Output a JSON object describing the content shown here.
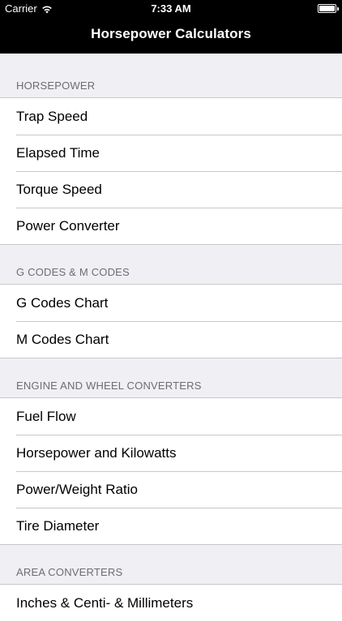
{
  "status_bar": {
    "carrier": "Carrier",
    "time": "7:33 AM"
  },
  "nav": {
    "title": "Horsepower Calculators"
  },
  "sections": [
    {
      "header": "HORSEPOWER",
      "items": [
        "Trap Speed",
        "Elapsed Time",
        "Torque Speed",
        "Power Converter"
      ]
    },
    {
      "header": "G CODES & M CODES",
      "items": [
        "G Codes Chart",
        "M Codes Chart"
      ]
    },
    {
      "header": "ENGINE AND WHEEL CONVERTERS",
      "items": [
        "Fuel Flow",
        "Horsepower and Kilowatts",
        "Power/Weight Ratio",
        "Tire Diameter"
      ]
    },
    {
      "header": "AREA CONVERTERS",
      "items": [
        "Inches & Centi- & Millimeters"
      ]
    }
  ]
}
